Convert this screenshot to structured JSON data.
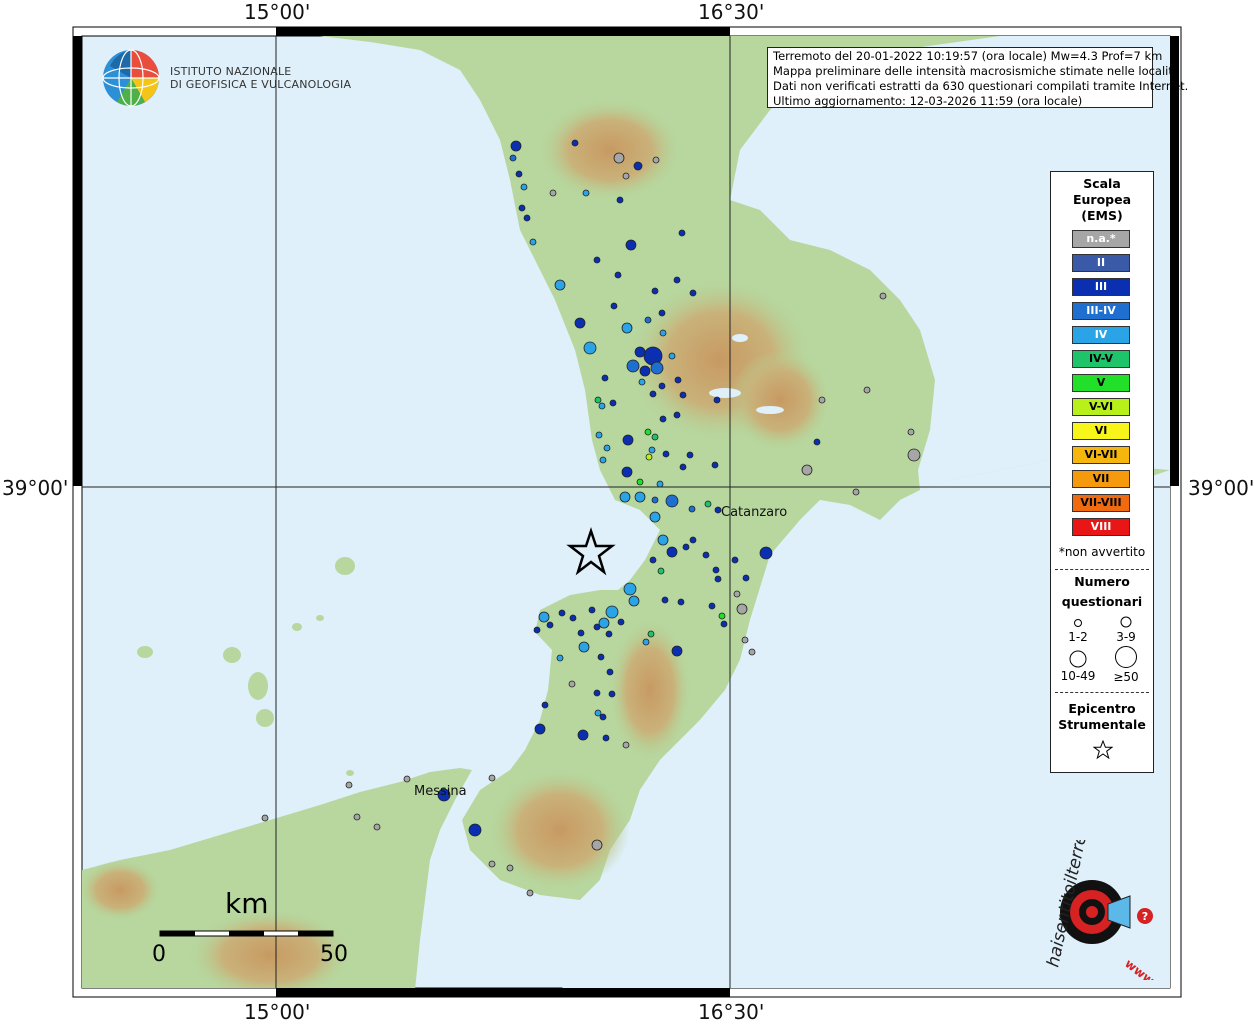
{
  "coordinates": {
    "lon_left": "15°00'",
    "lon_right": "16°30'",
    "lat": "39°00'"
  },
  "info": {
    "line1": "Terremoto del 20-01-2022 10:19:57 (ora locale) Mw=4.3 Prof=7 km",
    "line2": "Mappa preliminare delle intensità macrosismiche stimate nelle località",
    "line3": "Dati non verificati estratti da 630 questionari compilati tramite Internet.",
    "line4": "Ultimo aggiornamento: 12-03-2026 11:59 (ora locale)"
  },
  "ingv": {
    "line1": "ISTITUTO NAZIONALE",
    "line2": "DI GEOFISICA E VULCANOLOGIA"
  },
  "places": {
    "catanzaro": "Catanzaro",
    "messina": "Messina"
  },
  "scalebar": {
    "unit": "km",
    "min": "0",
    "max": "50"
  },
  "legend": {
    "title1": "Scala",
    "title2": "Europea",
    "title3": "(EMS)",
    "ems": [
      {
        "label": "n.a.*",
        "color": "#a6a6a6",
        "text": "#ffffff"
      },
      {
        "label": "II",
        "color": "#3a5aa8",
        "text": "#ffffff"
      },
      {
        "label": "III",
        "color": "#0a2fb0",
        "text": "#ffffff"
      },
      {
        "label": "III-IV",
        "color": "#1e6fd0",
        "text": "#ffffff"
      },
      {
        "label": "IV",
        "color": "#2aa4e6",
        "text": "#ffffff"
      },
      {
        "label": "IV-V",
        "color": "#1ec46a",
        "text": "#000000"
      },
      {
        "label": "V",
        "color": "#22e02a",
        "text": "#000000"
      },
      {
        "label": "V-VI",
        "color": "#b8f01a",
        "text": "#000000"
      },
      {
        "label": "VI",
        "color": "#f8f51a",
        "text": "#000000"
      },
      {
        "label": "VI-VII",
        "color": "#f5b70e",
        "text": "#000000"
      },
      {
        "label": "VII",
        "color": "#f59a0c",
        "text": "#000000"
      },
      {
        "label": "VII-VIII",
        "color": "#f06a10",
        "text": "#000000"
      },
      {
        "label": "VIII",
        "color": "#e81616",
        "text": "#ffffff"
      }
    ],
    "not_felt": "*non avvertito",
    "count_title1": "Numero",
    "count_title2": "questionari",
    "counts": [
      "1-2",
      "3-9",
      "10-49",
      "≥50"
    ],
    "epi_title1": "Epicentro",
    "epi_title2": "Strumentale"
  },
  "site": {
    "text": "haisentitoilterremoto.it",
    "prefix": "www.",
    "accent": "#d62222"
  },
  "colors": {
    "sea": "#dff0fb",
    "land_low": "#a9d39a",
    "land_mid": "#c9c58b",
    "land_high": "#b28a52"
  }
}
